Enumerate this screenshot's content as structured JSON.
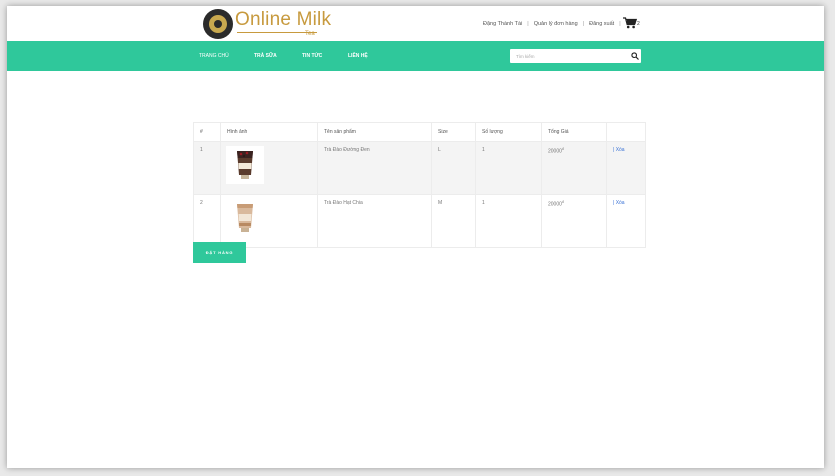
{
  "header": {
    "logo_text": "Online Milk",
    "logo_sub": "Tea",
    "user_link": "Đặng Thành Tài",
    "orders_link": "Quản lý đơn hàng",
    "logout_link": "Đăng xuất",
    "cart_count": "2",
    "separator": "|"
  },
  "nav": {
    "items": [
      "TRANG CHỦ",
      "TRÀ SỮA",
      "TIN TỨC",
      "LIÊN HỆ"
    ],
    "search_placeholder": "Tìm kiếm"
  },
  "cart_table": {
    "columns": [
      "#",
      "Hình ảnh",
      "Tên sản phẩm",
      "Size",
      "Số lượng",
      "Tổng Giá",
      ""
    ],
    "rows": [
      {
        "index": "1",
        "product": "Trà Đào Đường Đen",
        "size": "L",
        "qty": "1",
        "price": "20000",
        "currency": "đ",
        "action": "| Xóa"
      },
      {
        "index": "2",
        "product": "Trà Đào Hạt Chia",
        "size": "M",
        "qty": "1",
        "price": "20000",
        "currency": "đ",
        "action": "| Xóa"
      }
    ]
  },
  "order_button": "ĐẶT HÀNG",
  "colors": {
    "accent": "#2fc89b",
    "logo": "#c79a3e",
    "link": "#3b73d6"
  }
}
